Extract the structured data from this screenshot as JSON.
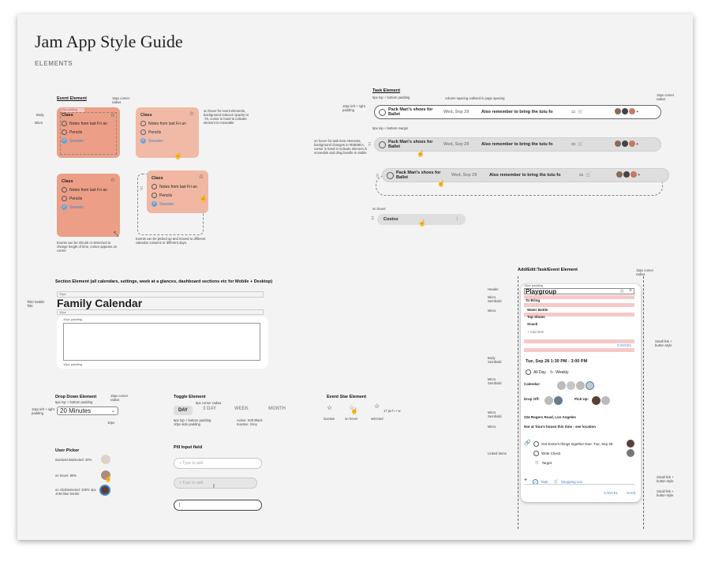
{
  "header": {
    "title": "Jam App Style Guide",
    "subtitle": "ELEMENTS"
  },
  "event_element": {
    "title": "Event Element",
    "corner_note": "15px corner radius",
    "padding_note": "10px padding",
    "body_label": "Body",
    "micro_label": "Micro",
    "card_title": "Class",
    "items": [
      "Notes from last Fri an",
      "Pencils",
      "Sweater"
    ],
    "hover_note": "on hover for event elements, background reduces opacity to .75, cursor is hand to indicate element is moveable",
    "resize_note": "Events can be shrunk or stretched to change length of time, cursor appears on corner",
    "move_note": "Events can be picked up and moved to different calendar columns or different days.",
    "colors": {
      "card": "#ec9f86",
      "card_light": "#f1b7a2"
    }
  },
  "task_element": {
    "title": "Task Element",
    "padding_note": "5px top + bottom padding",
    "column_note": "column spacing outlined in page spacing",
    "corner_note": "15px corner radius",
    "lr_note": "10px left + right padding",
    "margin_note": "5px top + bottom margin",
    "hover_note": "on hover for task item elements, background changes to #E8E8EA, cursor is hand to indicate element is moveable and drag handle is visible",
    "name": "Pack Mari's shoes for Ballet",
    "date": "Wed, Sep 29",
    "note": "Also remember to bring the tutu fo",
    "plus": "+",
    "on_hover": "on hover:",
    "costco": "Costco"
  },
  "section_element": {
    "title": "Section Element (all calendars, settings, week at a glances, dashboard sections etc for Mobile + Desktop)",
    "title_label": "Title/ Mobile Title",
    "top_px": "20px",
    "heading": "Family Calendar",
    "mid_px": "10px",
    "padding": "10px padding",
    "padding_side": "10px padding"
  },
  "dropdown": {
    "title": "Drop Down Element",
    "padding_note": "5px top + bottom padding",
    "corner_note": "15px corner radius",
    "lr_note": "10px left + right padding",
    "value": "20 Minutes",
    "px_note": "10px"
  },
  "toggle": {
    "title": "Toggle Element",
    "corner_note": "6px corner radius",
    "options": [
      "DAY",
      "3 DAY",
      "WEEK",
      "MONTH"
    ],
    "padding_note": "5px top + bottom padding 10px side padding",
    "active_note": "Active: Soft Black Inactive: Grey"
  },
  "star": {
    "title": "Event Star Element",
    "note": "17 px h + w",
    "inactive": "inactive",
    "hover": "on hover",
    "selected": "selected"
  },
  "user_picker": {
    "title": "User Picker",
    "inactive": "inactive/unselected: 40%",
    "hover": "on hover: 80%",
    "selected": "on click/selected: 100% 4px JAM blue border"
  },
  "pill_input": {
    "title": "Pill Input field",
    "placeholder": "+ Type to add"
  },
  "form": {
    "title": "Add/Edit:Task/Event Element",
    "corner_note": "15px corner radius",
    "header_padding": "15px padding",
    "header_label": "Header",
    "micro_semibold": "Micro Semibold",
    "micro": "Micro",
    "body_semibold": "Body Semibold",
    "linked_items": "Linked Items",
    "small_link": "Small link + button style",
    "heading": "Playgroup",
    "pink_height": "20px height",
    "to_bring": "To Bring",
    "bring_items": [
      "Water Bottle",
      "Top Shoes",
      "Snack"
    ],
    "add_item": "+ Add item",
    "cancel": "CANCEL",
    "save": "SAVE",
    "date": "Tue, Sep 28  1:30 PM - 3:00 PM",
    "all_day": "All Day",
    "weekly": "Weekly",
    "calendar_label": "Calendar:",
    "drop_off": "Drop Off:",
    "pick_up": "Pick Up:",
    "address": "234 Rogers Road, Los Angeles",
    "note": "Not at Tara's house this time - see location",
    "linked": [
      "Get Esme's things together  Due: Tue, Sep 28",
      "Write Check",
      "Target"
    ],
    "task_btn": "Task",
    "shopping_btn": "Shopping List",
    "side_padding": "10px padding"
  }
}
